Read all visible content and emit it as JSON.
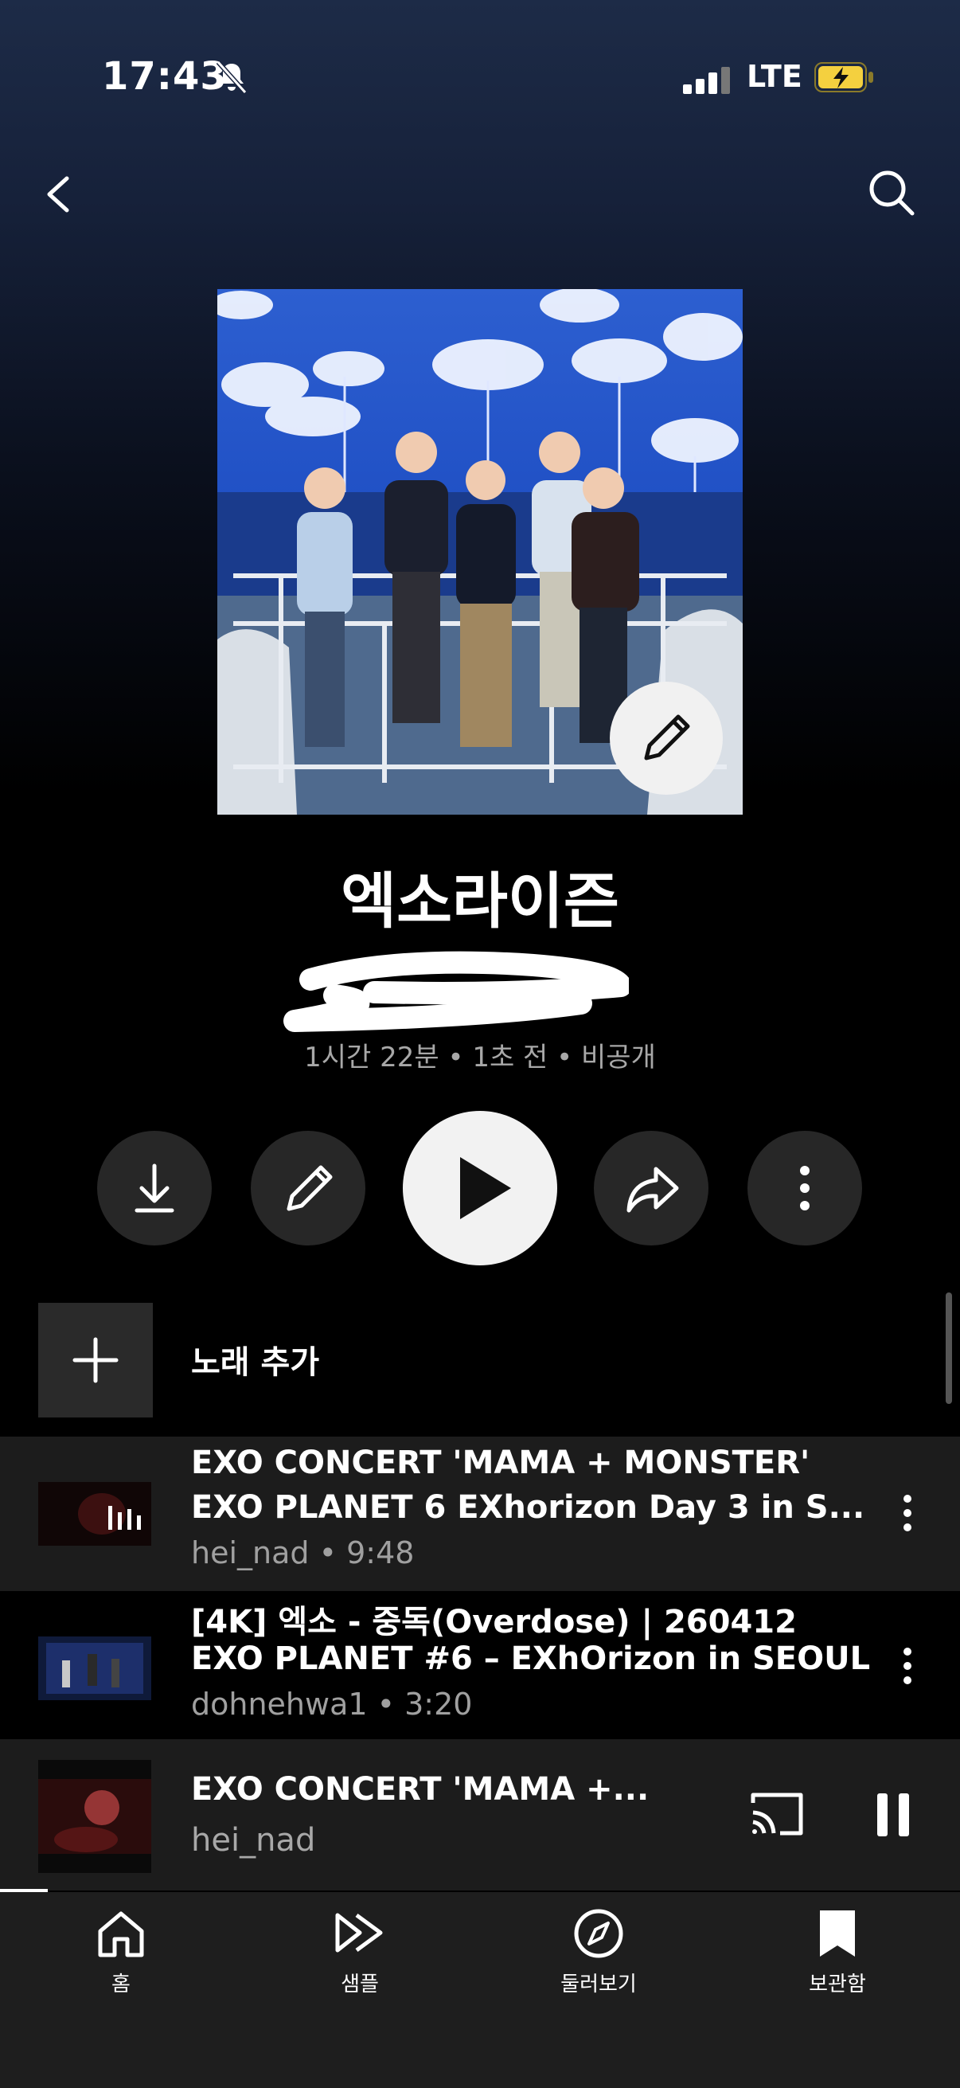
{
  "status_bar": {
    "time": "17:43",
    "network": "LTE"
  },
  "playlist": {
    "title": "엑소라이즌",
    "meta": "1시간 22분 • 1초 전 • 비공개"
  },
  "add_song": {
    "label": "노래 추가"
  },
  "tracks": [
    {
      "line1": "EXO CONCERT 'MAMA + MONSTER'",
      "line2": "EXO PLANET 6 EXhorizon Day 3 in S...",
      "sub": "hei_nad • 9:48",
      "playing": true
    },
    {
      "line1": "[4K] 엑소 - 중독(Overdose) | 260412",
      "line2": "EXO PLANET #6 – EXhOrizon in SEOUL",
      "sub": "dohnehwa1 • 3:20",
      "playing": false
    }
  ],
  "now_playing": {
    "title": "EXO CONCERT 'MAMA +...",
    "artist": "hei_nad",
    "progress": 0.05
  },
  "bottom_nav": [
    {
      "label": "홈",
      "icon": "home-icon"
    },
    {
      "label": "샘플",
      "icon": "samples-icon"
    },
    {
      "label": "둘러보기",
      "icon": "explore-icon"
    },
    {
      "label": "보관함",
      "icon": "library-icon"
    }
  ],
  "colors": {
    "background": "#000000",
    "surface": "#1c1c1c",
    "button": "#272727",
    "battery": "#f4d03f"
  }
}
